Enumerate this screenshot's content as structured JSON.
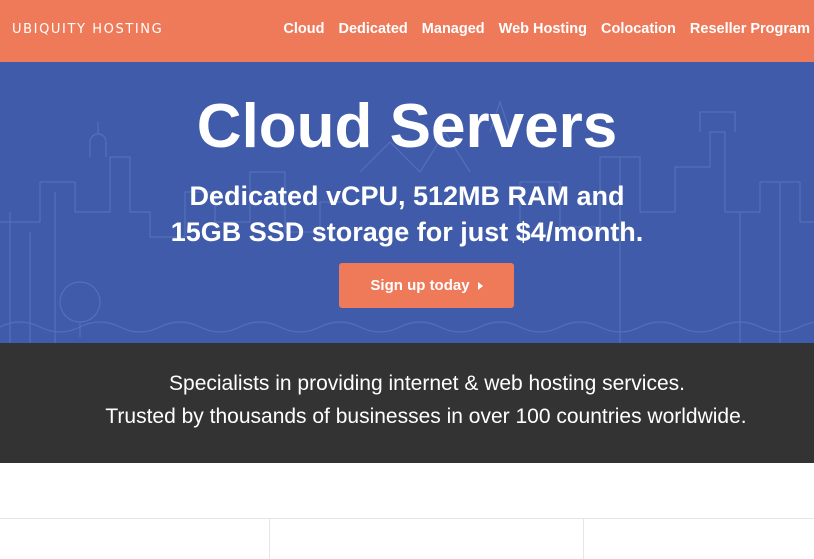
{
  "header": {
    "logo": "UBIQUITY HOSTING",
    "nav": [
      "Cloud",
      "Dedicated",
      "Managed",
      "Web Hosting",
      "Colocation",
      "Reseller Program"
    ]
  },
  "hero": {
    "title": "Cloud Servers",
    "subtitle_line1": "Dedicated vCPU, 512MB RAM and",
    "subtitle_line2": "15GB SSD storage for just $4/month.",
    "cta_label": "Sign up today",
    "cta_icon": "caret-right-icon"
  },
  "band": {
    "line1": "Specialists in providing internet & web hosting services.",
    "line2": "Trusted by thousands of businesses in over 100 countries worldwide."
  },
  "colors": {
    "header_bg": "#ee7a5a",
    "hero_bg": "#3f5ba9",
    "band_bg": "#333333",
    "accent": "#ee7a5a"
  }
}
